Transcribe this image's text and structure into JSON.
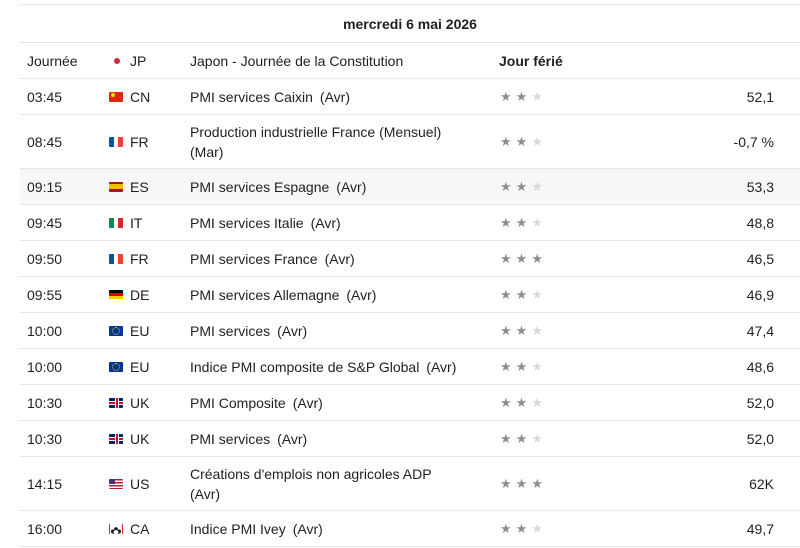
{
  "date_header": "mercredi 6 mai 2026",
  "holiday_row": {
    "time": "Journée",
    "country": "JP",
    "event": "Japon - Journée de la Constitution",
    "status": "Jour férié"
  },
  "rows": [
    {
      "time": "03:45",
      "country": "CN",
      "flag": "flag-china-icon",
      "event": "PMI services Caixin (Avr)",
      "importance": 2,
      "value": "52,1"
    },
    {
      "time": "08:45",
      "country": "FR",
      "flag": "flag-france-icon",
      "event": "Production industrielle France (Mensuel)\n(Mar)",
      "importance": 2,
      "value": "-0,7 %"
    },
    {
      "time": "09:15",
      "country": "ES",
      "flag": "flag-spain-icon",
      "event": "PMI services Espagne (Avr)",
      "importance": 2,
      "value": "53,3"
    },
    {
      "time": "09:45",
      "country": "IT",
      "flag": "flag-italy-icon",
      "event": "PMI services Italie (Avr)",
      "importance": 2,
      "value": "48,8"
    },
    {
      "time": "09:50",
      "country": "FR",
      "flag": "flag-france-icon",
      "event": "PMI services France (Avr)",
      "importance": 3,
      "value": "46,5"
    },
    {
      "time": "09:55",
      "country": "DE",
      "flag": "flag-germany-icon",
      "event": "PMI services Allemagne (Avr)",
      "importance": 2,
      "value": "46,9"
    },
    {
      "time": "10:00",
      "country": "EU",
      "flag": "flag-eu-icon",
      "event": "PMI services (Avr)",
      "importance": 2,
      "value": "47,4"
    },
    {
      "time": "10:00",
      "country": "EU",
      "flag": "flag-eu-icon",
      "event": "Indice PMI composite de S&P Global (Avr)",
      "importance": 2,
      "value": "48,6"
    },
    {
      "time": "10:30",
      "country": "UK",
      "flag": "flag-uk-icon",
      "event": "PMI Composite (Avr)",
      "importance": 2,
      "value": "52,0"
    },
    {
      "time": "10:30",
      "country": "UK",
      "flag": "flag-uk-icon",
      "event": "PMI services (Avr)",
      "importance": 2,
      "value": "52,0"
    },
    {
      "time": "14:15",
      "country": "US",
      "flag": "flag-usa-icon",
      "event": "Créations d'emplois non agricoles ADP\n(Avr)",
      "importance": 3,
      "value": "62K"
    },
    {
      "time": "16:00",
      "country": "CA",
      "flag": "flag-canada-icon",
      "event": "Indice PMI Ivey (Avr)",
      "importance": 2,
      "value": "49,7"
    }
  ],
  "colors": {
    "star_active": "#8e8e8e",
    "star_inactive": "#d9d9d9",
    "row_shaded": "#f7f7f7"
  }
}
